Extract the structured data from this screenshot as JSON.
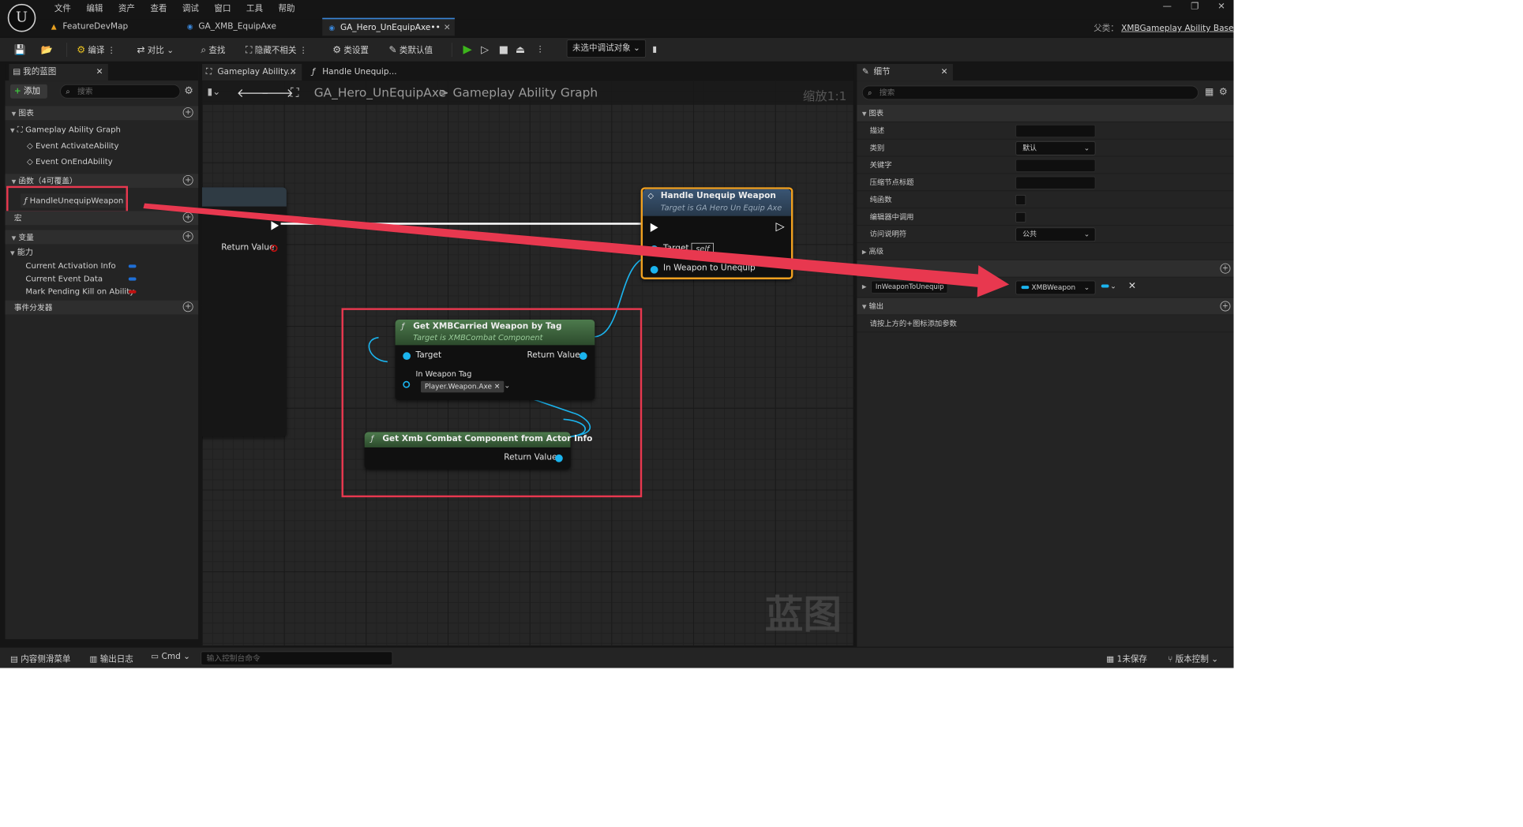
{
  "menu": [
    "文件",
    "编辑",
    "资产",
    "查看",
    "调试",
    "窗口",
    "工具",
    "帮助"
  ],
  "doc_tabs": [
    {
      "label": "FeatureDevMap"
    },
    {
      "label": "GA_XMB_EquipAxe"
    },
    {
      "label": "GA_Hero_UnEquipAxe••"
    }
  ],
  "parent_class": {
    "prefix": "父类：",
    "name": "XMBGameplay Ability Base"
  },
  "toolbar": {
    "compile": "编译",
    "diff": "对比",
    "find": "查找",
    "hide_unrelated": "隐藏不相关",
    "class_settings": "类设置",
    "class_defaults": "类默认值",
    "debug_object": "未选中调试对象"
  },
  "left_panel": {
    "tab": "我的蓝图",
    "add": "添加",
    "search_placeholder": "搜索",
    "graphs_header": "图表",
    "graph_name": "Gameplay Ability Graph",
    "events": [
      "Event ActivateAbility",
      "Event OnEndAbility"
    ],
    "functions_header": "函数（4可覆盖）",
    "function_item": "HandleUnequipWeapon",
    "macros_header": "宏",
    "variables_header": "变量",
    "category": "能力",
    "variables": [
      {
        "name": "Current Activation Info",
        "color": "#1f6fd6"
      },
      {
        "name": "Current Event Data",
        "color": "#1f6fd6"
      },
      {
        "name": "Mark Pending Kill on Ability",
        "color": "#c01010"
      }
    ],
    "dispatchers_header": "事件分发器"
  },
  "graph": {
    "tabs": [
      "Gameplay Ability...",
      "Handle Unequip..."
    ],
    "breadcrumb_root": "GA_Hero_UnEquipAxe",
    "breadcrumb_sep": ">",
    "breadcrumb_leaf": "Gameplay Ability Graph",
    "zoom": "缩放1:1",
    "watermark": "蓝图",
    "entry_node": {
      "return_label": "Return Value"
    },
    "call_node": {
      "title": "Handle Unequip Weapon",
      "subtitle": "Target is GA Hero Un Equip Axe",
      "target_label": "Target",
      "target_value": "self",
      "weapon_label": "In Weapon to Unequip"
    },
    "get_weapon_node": {
      "title": "Get XMBCarried Weapon by Tag",
      "subtitle": "Target is XMBCombat Component",
      "target_label": "Target",
      "return_label": "Return Value",
      "tag_label": "In Weapon Tag",
      "tag_value": "Player.Weapon.Axe"
    },
    "get_component_node": {
      "title": "Get Xmb Combat Component from Actor Info",
      "return_label": "Return Value"
    }
  },
  "details": {
    "tab": "细节",
    "search_placeholder": "搜索",
    "graph_header": "图表",
    "rows": [
      {
        "label": "描述"
      },
      {
        "label": "类别",
        "value": "默认"
      },
      {
        "label": "关键字"
      },
      {
        "label": "压缩节点标题"
      },
      {
        "label": "纯函数"
      },
      {
        "label": "编辑器中调用"
      },
      {
        "label": "访问说明符",
        "value": "公共"
      }
    ],
    "advanced": "高级",
    "input_param": {
      "name": "InWeaponToUnequip",
      "type": "XMBWeapon",
      "color": "#1bb4ee"
    },
    "output_header": "输出",
    "output_hint": "请按上方的+图标添加参数"
  },
  "status": {
    "content_drawer": "内容侧滑菜单",
    "output_log": "输出日志",
    "cmd": "Cmd",
    "cmd_placeholder": "输入控制台命令",
    "unsaved": "1未保存",
    "source_control": "版本控制"
  },
  "colors": {
    "accent": "#3a86d8",
    "highlight": "#e8384f",
    "node_border": "#f0a020",
    "pin_object": "#1bb4ee"
  }
}
